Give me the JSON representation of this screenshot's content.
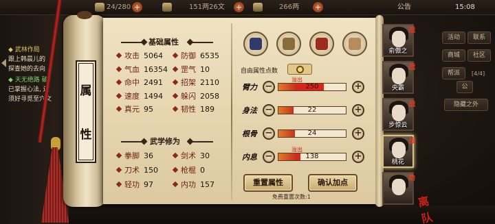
{
  "topbar": {
    "stamina": "24/280",
    "silver": "151两26文",
    "ingot": "266两",
    "announce": "公告",
    "time": "15:08"
  },
  "quest": {
    "lines": [
      {
        "text": "◆ 武林作局",
        "color": "#d9c56a"
      },
      {
        "text": "跟上韩晨儿的",
        "color": "#e8dcc0"
      },
      {
        "text": "探查她的去向",
        "color": "#e8dcc0"
      },
      {
        "text": "◆ 天无绝路 破",
        "color": "#7ed36a"
      },
      {
        "text": "已掌握心法, 还",
        "color": "#e8dcc0"
      },
      {
        "text": "须好寻觅至穴文",
        "color": "#e8dcc0"
      }
    ]
  },
  "right_menu": {
    "buttons": [
      "活动",
      "联系",
      "商城",
      "社区",
      "帮派"
    ],
    "counter": "[4/4]",
    "hide": "隐藏之外",
    "tab": "公"
  },
  "scroll": {
    "vertical_title": [
      "属",
      "性"
    ]
  },
  "basic": {
    "title": "基础属性",
    "stats": [
      {
        "label": "攻击",
        "value": "5064"
      },
      {
        "label": "防御",
        "value": "6535"
      },
      {
        "label": "气血",
        "value": "16354"
      },
      {
        "label": "罡气",
        "value": "10"
      },
      {
        "label": "命中",
        "value": "2491"
      },
      {
        "label": "招架",
        "value": "2110"
      },
      {
        "label": "速度",
        "value": "1494"
      },
      {
        "label": "躲闪",
        "value": "2058"
      },
      {
        "label": "真元",
        "value": "95"
      },
      {
        "label": "韧性",
        "value": "189"
      }
    ]
  },
  "martial": {
    "title": "武学修为",
    "stats": [
      {
        "label": "拳脚",
        "value": "36"
      },
      {
        "label": "剑术",
        "value": "30"
      },
      {
        "label": "刀术",
        "value": "150"
      },
      {
        "label": "枪棍",
        "value": "0"
      },
      {
        "label": "轻功",
        "value": "97"
      },
      {
        "label": "内功",
        "value": "157"
      }
    ]
  },
  "tabs": [
    {
      "name": "attributes-tab",
      "icon": "warrior-icon",
      "color": "#2f3b6b"
    },
    {
      "name": "skills-tab",
      "icon": "scroll-icon",
      "color": "#8a6b3a"
    },
    {
      "name": "meridian-tab",
      "icon": "yin-yang-icon",
      "color": "#9b2b1c"
    },
    {
      "name": "body-tab",
      "icon": "figure-icon",
      "color": "#b88b5a"
    }
  ],
  "free_points": {
    "label": "自由属性点数",
    "value": "0"
  },
  "attributes": [
    {
      "label": "臂力",
      "value": "250",
      "fraction": 0.25,
      "overflow": true,
      "overflow_fraction": 0.42
    },
    {
      "label": "身法",
      "value": "22",
      "fraction": 0.22,
      "overflow": false,
      "overflow_fraction": 0
    },
    {
      "label": "根骨",
      "value": "24",
      "fraction": 0.24,
      "overflow": false,
      "overflow_fraction": 0
    },
    {
      "label": "内息",
      "value": "138",
      "fraction": 0.25,
      "overflow": true,
      "overflow_fraction": 0.08
    }
  ],
  "overflow_text": "溢出",
  "buttons": {
    "reset": "重置属性",
    "confirm": "确认加点",
    "reset_count": "免费重置次数:1"
  },
  "party": [
    {
      "name": "俞傲之",
      "badge": "战"
    },
    {
      "name": "央霸",
      "badge": "战"
    },
    {
      "name": "步惊云",
      "badge": "战"
    },
    {
      "name": "桃花",
      "badge": "战"
    },
    {
      "name": "",
      "badge": "助"
    }
  ],
  "leave": "离队"
}
